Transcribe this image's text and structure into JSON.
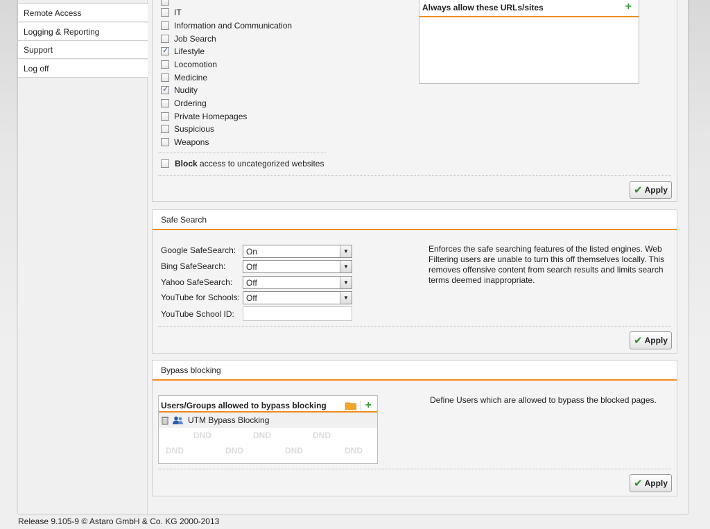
{
  "sidebar": {
    "items": [
      {
        "label": "Remote Access"
      },
      {
        "label": "Logging & Reporting"
      },
      {
        "label": "Support"
      },
      {
        "label": "Log off"
      }
    ]
  },
  "categories": {
    "items": [
      {
        "label": "IT",
        "checked": false
      },
      {
        "label": "Information and Communication",
        "checked": false
      },
      {
        "label": "Job Search",
        "checked": false
      },
      {
        "label": "Lifestyle",
        "checked": true
      },
      {
        "label": "Locomotion",
        "checked": false
      },
      {
        "label": "Medicine",
        "checked": false
      },
      {
        "label": "Nudity",
        "checked": true
      },
      {
        "label": "Ordering",
        "checked": false
      },
      {
        "label": "Private Homepages",
        "checked": false
      },
      {
        "label": "Suspicious",
        "checked": false
      },
      {
        "label": "Weapons",
        "checked": false
      }
    ],
    "uncategorized": {
      "bold": "Block",
      "rest": " access to uncategorized websites",
      "checked": false
    },
    "allow_box_title": "Always allow these URLs/sites",
    "apply_label": "Apply"
  },
  "safe_search": {
    "title": "Safe Search",
    "fields": [
      {
        "label": "Google SafeSearch:",
        "value": "On"
      },
      {
        "label": "Bing SafeSearch:",
        "value": "Off"
      },
      {
        "label": "Yahoo SafeSearch:",
        "value": "Off"
      },
      {
        "label": "YouTube for Schools:",
        "value": "Off"
      }
    ],
    "school_id_label": "YouTube School ID:",
    "school_id_value": "",
    "description": "Enforces the safe searching features of the listed engines. Web Filtering users are unable to turn this off themselves locally. This removes offensive content from search results and limits search terms deemed inappropriate.",
    "apply_label": "Apply"
  },
  "bypass": {
    "title": "Bypass blocking",
    "box_title": "Users/Groups allowed to bypass blocking",
    "entries": [
      {
        "label": "UTM Bypass Blocking"
      }
    ],
    "dnd_text": "DND",
    "description": "Define Users which are allowed to bypass the blocked pages.",
    "apply_label": "Apply"
  },
  "footer": {
    "text": "Release 9.105-9  © Astaro GmbH & Co. KG 2000-2013"
  },
  "colors": {
    "accent": "#f08c1e",
    "plus": "#39a039",
    "check": "#2e8b2e"
  }
}
